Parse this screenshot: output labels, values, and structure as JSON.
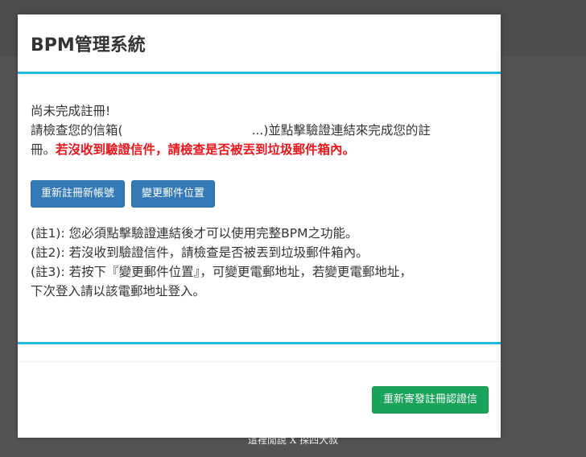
{
  "modal": {
    "title": "BPM管理系統",
    "line1": "尚未完成註冊!",
    "line2_prefix": "請檢查您的信箱(",
    "line2_suffix": "...)並點擊驗證連結來完成您的註",
    "line3_prefix": "冊。",
    "line3_warning": "若沒收到驗證信件，請檢查是否被丟到垃圾郵件箱內。",
    "buttons": {
      "reregister": "重新註冊新帳號",
      "change_email": "變更郵件位置"
    },
    "notes": [
      "(註1): 您必須點擊驗證連結後才可以使用完整BPM之功能。",
      "(註2): 若沒收到驗證信件，請檢查是否被丟到垃圾郵件箱內。",
      "(註3): 若按下『變更郵件位置』，可變更電郵地址，若變更電郵地址，",
      "下次登入請以該電郵地址登入。"
    ],
    "resend_button": "重新寄發註冊認證信"
  },
  "background_text": "這裡閒說 X 探四大叔",
  "colors": {
    "accent_line": "#1fb6e6",
    "primary_button": "#337ab7",
    "success_button": "#1aa35b",
    "warning_text": "#e8171c"
  }
}
